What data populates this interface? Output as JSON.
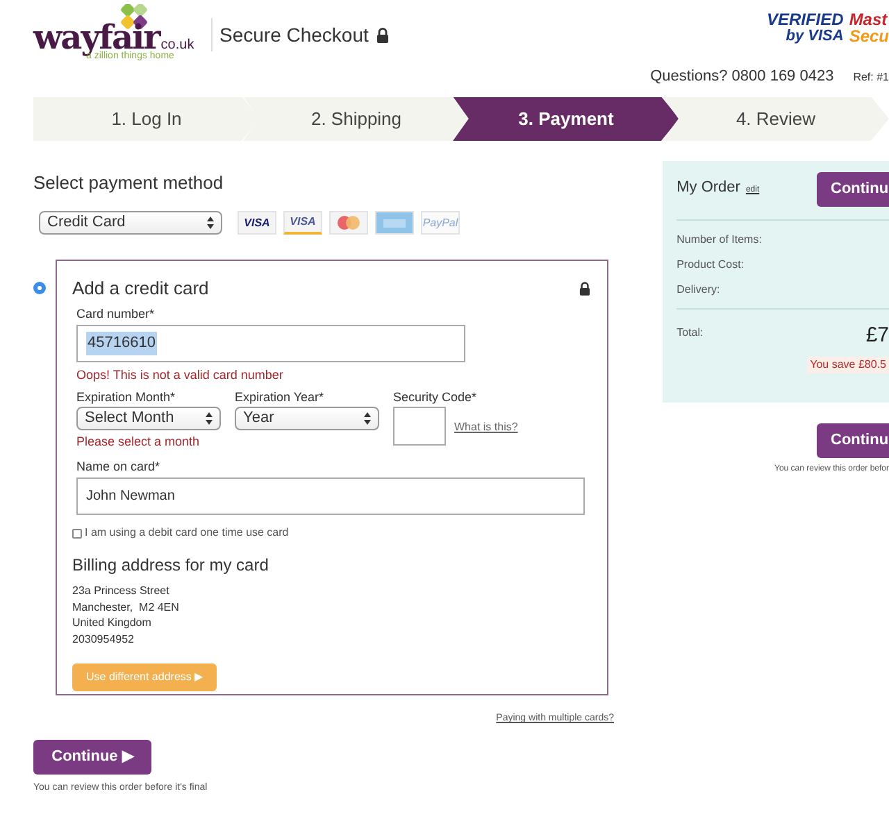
{
  "header": {
    "logo": {
      "name": "wayfair",
      "domain": "co.uk",
      "tagline": "a zillion things home"
    },
    "title": "Secure Checkout",
    "badges": [
      {
        "kind": "visa",
        "lines": [
          "VERIFIED",
          "by VISA"
        ]
      },
      {
        "kind": "mastercard",
        "lines": [
          "Mast",
          "Secu"
        ]
      }
    ],
    "questions": "Questions? 0800 169 0423",
    "ref": "Ref: #1"
  },
  "steps": [
    {
      "label": "1. Log In",
      "selected": false
    },
    {
      "label": "2. Shipping",
      "selected": false
    },
    {
      "label": "3. Payment",
      "selected": true
    },
    {
      "label": "4. Review",
      "selected": false
    }
  ],
  "payment": {
    "heading": "Select payment method",
    "method": "Credit Card",
    "cards": [
      {
        "kind": "visa",
        "label": "VISA"
      },
      {
        "kind": "visa-electron",
        "label": "VISA"
      },
      {
        "kind": "mastercard"
      },
      {
        "kind": "amex"
      },
      {
        "kind": "paypal",
        "label": "PayPal"
      }
    ]
  },
  "card_form": {
    "selected": true,
    "title": "Add a credit card",
    "card_number": {
      "label": "Card number*",
      "value": "45716610",
      "error": "Oops! This is not a valid card number"
    },
    "month": {
      "label": "Expiration Month*",
      "value": "Select Month",
      "error": "Please select a month"
    },
    "year": {
      "label": "Expiration Year*",
      "value": "Year"
    },
    "security": {
      "label": "Security Code*",
      "link": "What is this?"
    },
    "name": {
      "label": "Name on card*",
      "value": "John Newman"
    },
    "debit": {
      "label": "I am using a debit card one time use card",
      "checked": false
    },
    "billing": {
      "heading": "Billing address for my card",
      "lines": [
        "23a Princess Street",
        "Manchester,  M2 4EN",
        "United Kingdom",
        "2030954952"
      ]
    },
    "address_button": "Use different address ▶"
  },
  "multiple_cards_link": "Paying with multiple cards?",
  "continue": {
    "label": "Continue ▶",
    "note": "You can review this order before it's final"
  },
  "order": {
    "title": "My Order",
    "edit": "edit",
    "continue": "Continu",
    "rows": [
      "Number of Items:",
      "Product Cost:",
      "Delivery:"
    ],
    "total_label": "Total:",
    "total": "£7",
    "savings": "You save £80.5"
  },
  "side_continue": {
    "label": "Continu",
    "note": "You can review this order befor"
  }
}
